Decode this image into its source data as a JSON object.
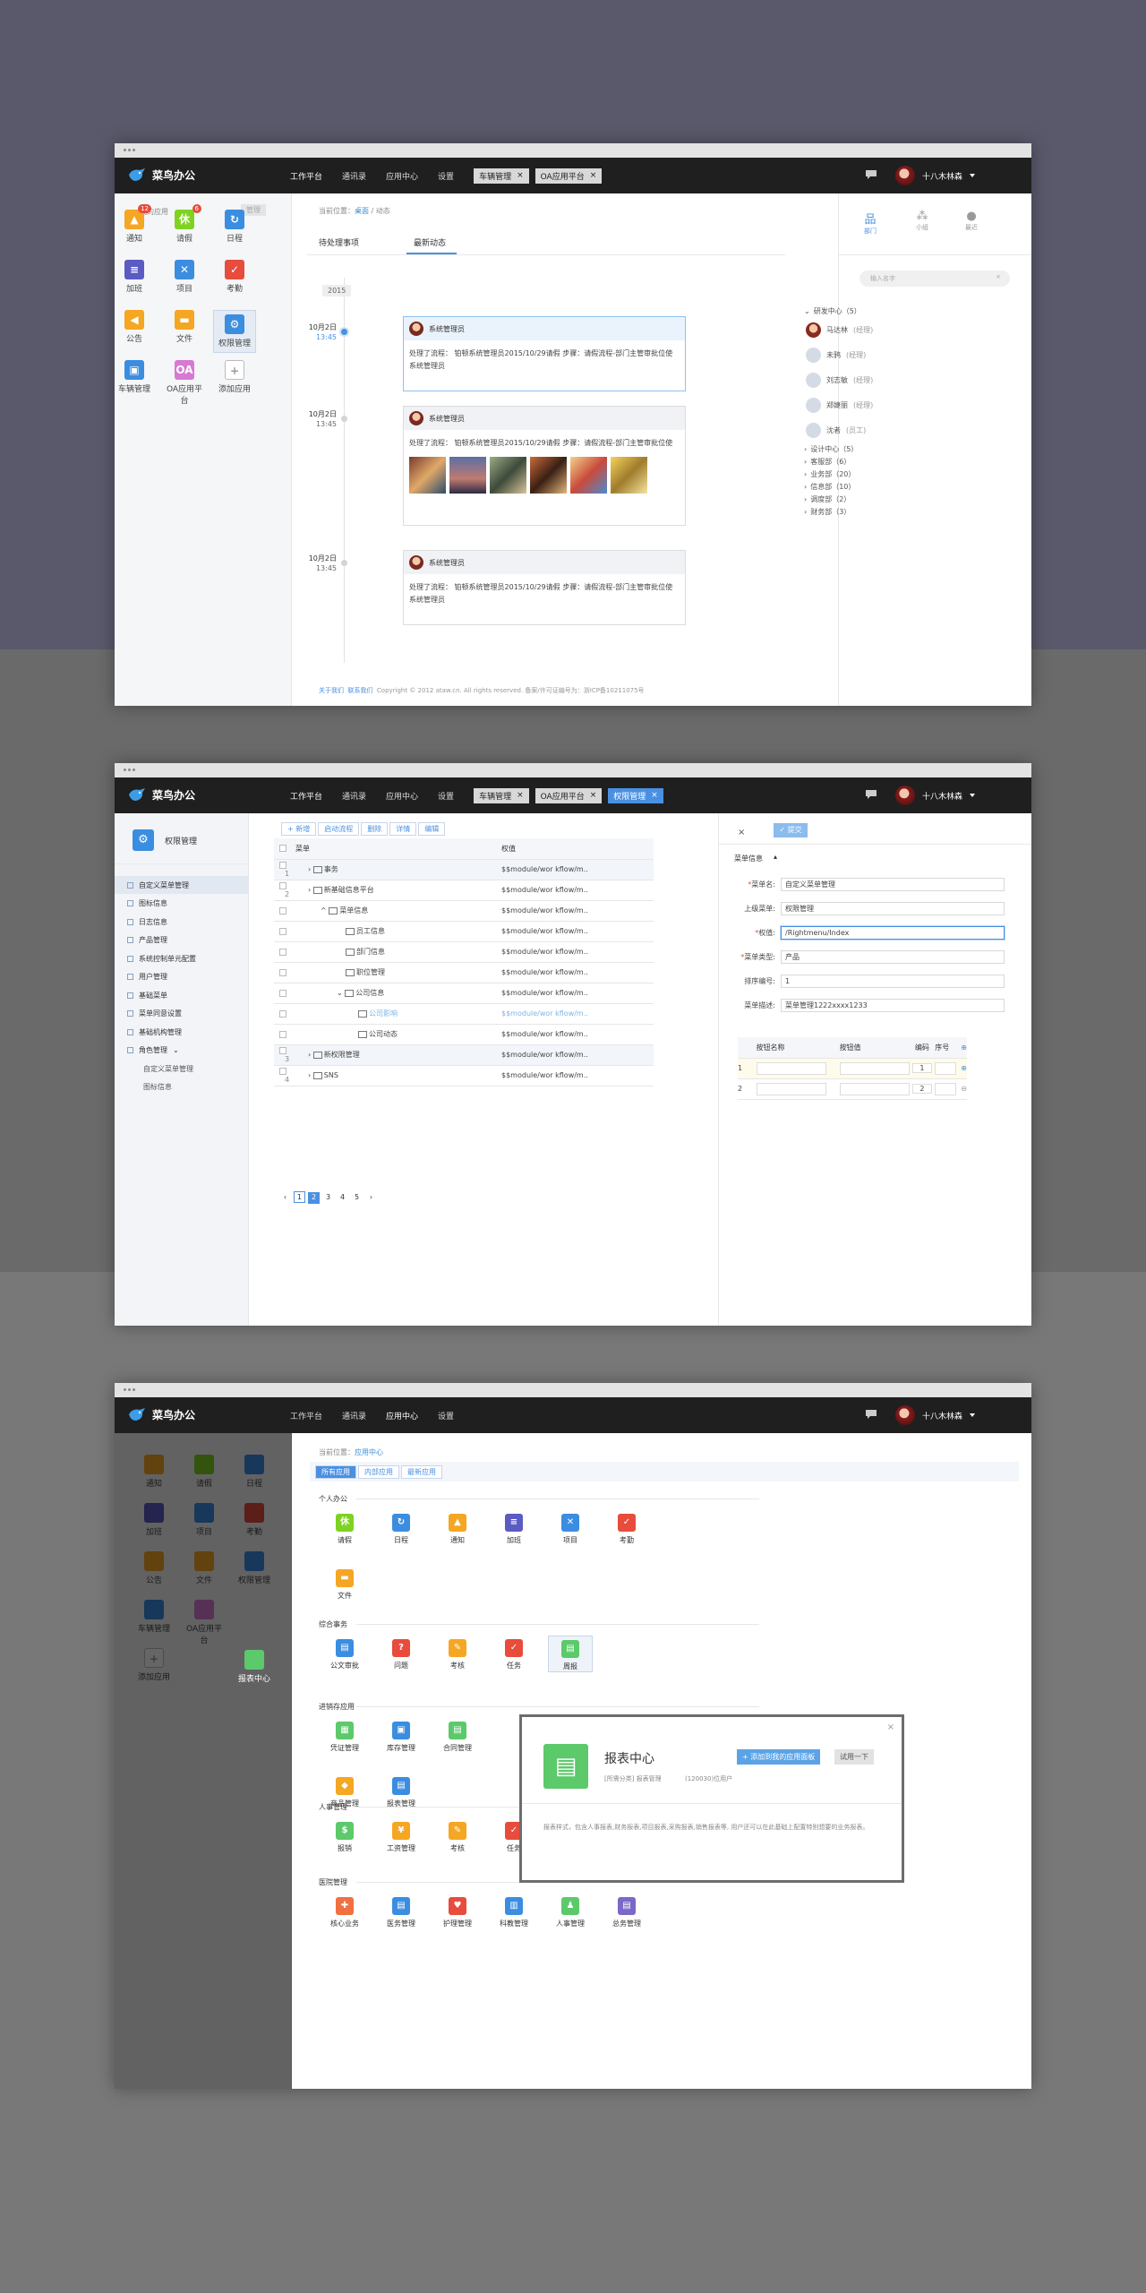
{
  "brand": "菜鸟办公",
  "nav": {
    "work": "工作平台",
    "contacts": "通讯录",
    "appcenter": "应用中心",
    "settings": "设置"
  },
  "tabs": {
    "vehicle": "车辆管理",
    "oa": "OA应用平台",
    "perm": "权限管理",
    "close": "×"
  },
  "user": {
    "name": "十八木林森"
  },
  "w1": {
    "my_apps": "我的应用",
    "manage": "管理",
    "apps": [
      {
        "label": "通知",
        "badge": "12",
        "color": "#f5a623",
        "glyph": "▲"
      },
      {
        "label": "请假",
        "badge": "6",
        "color": "#7ed321",
        "glyph": "休"
      },
      {
        "label": "日程",
        "badge": "",
        "color": "#3b8de0",
        "glyph": "↻"
      },
      {
        "label": "加班",
        "badge": "",
        "color": "#5b5bc4",
        "glyph": "≡"
      },
      {
        "label": "项目",
        "badge": "",
        "color": "#3b8de0",
        "glyph": "✕"
      },
      {
        "label": "考勤",
        "badge": "",
        "color": "#e74c3c",
        "glyph": "✓"
      },
      {
        "label": "公告",
        "badge": "",
        "color": "#f5a623",
        "glyph": "◀"
      },
      {
        "label": "文件",
        "badge": "",
        "color": "#f5a623",
        "glyph": "▬"
      },
      {
        "label": "权限管理",
        "badge": "",
        "color": "#3b8de0",
        "glyph": "⚙"
      },
      {
        "label": "车辆管理",
        "badge": "",
        "color": "#3b8de0",
        "glyph": "▣"
      },
      {
        "label": "OA应用平台",
        "badge": "",
        "color": "#d67ad4",
        "glyph": "OA"
      },
      {
        "label": "添加应用",
        "badge": "",
        "color": "#fff",
        "glyph": "+"
      }
    ],
    "crumb_prefix": "当前位置：",
    "crumb_home": "桌面",
    "crumb_sep": "/",
    "crumb_cur": "动态",
    "tab_todo": "待处理事项",
    "tab_news": "最新动态",
    "year": "2015",
    "items": [
      {
        "date": "10月2日",
        "time": "13:45",
        "author": "系统管理员",
        "body": "处理了流程：    铂顿系统管理员2015/10/29请假 步骤：请假流程-部门主管审批位使系统管理员"
      },
      {
        "date": "10月2日",
        "time": "13:45",
        "author": "系统管理员",
        "body": "处理了流程：    铂顿系统管理员2015/10/29请假 步骤：请假流程-部门主管审批位使"
      },
      {
        "date": "10月2日",
        "time": "13:45",
        "author": "系统管理员",
        "body": "处理了流程：    铂顿系统管理员2015/10/29请假 步骤：请假流程-部门主管审批位使系统管理员"
      }
    ],
    "footer": {
      "about": "关于我们",
      "contact": "联系我们",
      "copy": "Copyright © 2012 ataw.cn. All rights reserved. 备案/许可证编号为：浙ICP备10211075号"
    },
    "rtabs": [
      "部门",
      "小组",
      "最近"
    ],
    "search_ph": "输入名字",
    "dept_top": "研发中心（5）",
    "people": [
      {
        "name": "马达林",
        "role": "(经理)"
      },
      {
        "name": "未鸦",
        "role": "(经理)"
      },
      {
        "name": "刘志敏",
        "role": "(经理)"
      },
      {
        "name": "郑婕丽",
        "role": "(经理)"
      },
      {
        "name": "沈者",
        "role": "(员工)"
      }
    ],
    "depts": [
      "设计中心（5）",
      "客服部（6）",
      "业务部（20）",
      "信息部（10）",
      "调度部（2）",
      "财务部（3）"
    ]
  },
  "w2": {
    "module": "权限管理",
    "menu": [
      "自定义菜单管理",
      "图标信息",
      "日志信息",
      "产品管理",
      "系统控制单元配置",
      "用户管理",
      "基础菜单",
      "菜单同意设置",
      "基础机构管理",
      "角色管理"
    ],
    "menu_sub": [
      "自定义菜单管理",
      "图标信息"
    ],
    "toolbar": [
      "+ 新增",
      "启动流程",
      "删除",
      "详情",
      "编辑"
    ],
    "col_menu": "菜单",
    "col_perm": "权值",
    "rows": [
      {
        "no": "1",
        "name": "事务",
        "perm": "$$module/wor kflow/m.."
      },
      {
        "no": "2",
        "name": "新基础信息平台",
        "perm": "$$module/wor kflow/m.."
      },
      {
        "no": "",
        "name": "菜单信息",
        "perm": "$$module/wor kflow/m.."
      },
      {
        "no": "",
        "name": "员工信息",
        "perm": "$$module/wor kflow/m.."
      },
      {
        "no": "",
        "name": "部门信息",
        "perm": "$$module/wor kflow/m.."
      },
      {
        "no": "",
        "name": "职位管理",
        "perm": "$$module/wor kflow/m.."
      },
      {
        "no": "",
        "name": "公司信息",
        "perm": "$$module/wor kflow/m.."
      },
      {
        "no": "",
        "name": "公司影响",
        "perm": "$$module/wor kflow/m.."
      },
      {
        "no": "",
        "name": "公司动态",
        "perm": "$$module/wor kflow/m.."
      },
      {
        "no": "3",
        "name": "新权限管理",
        "perm": "$$module/wor kflow/m.."
      },
      {
        "no": "4",
        "name": "SNS",
        "perm": "$$module/wor kflow/m.."
      }
    ],
    "pager": [
      "‹",
      "1",
      "2",
      "3",
      "4",
      "5",
      "›"
    ],
    "submit": "✓ 提交",
    "section": "菜单信息",
    "fields": [
      {
        "label": "菜单名:",
        "req": "*",
        "value": "自定义菜单管理"
      },
      {
        "label": "上级菜单:",
        "req": "",
        "value": "权限管理"
      },
      {
        "label": "权值:",
        "req": "*",
        "value": "/Rightmenu/Index"
      },
      {
        "label": "菜单类型:",
        "req": "*",
        "value": "产品"
      },
      {
        "label": "排序编号:",
        "req": "",
        "value": "1"
      },
      {
        "label": "菜单描述:",
        "req": "",
        "value": "菜单管理1222xxxx1233"
      }
    ],
    "grid_head": [
      "按钮名称",
      "按钮值",
      "编码",
      "序号"
    ],
    "grid_rows": [
      {
        "n": "1",
        "code": "1"
      },
      {
        "n": "2",
        "code": "2"
      }
    ]
  },
  "w3": {
    "crumb_prefix": "当前位置：",
    "crumb_cur": "应用中心",
    "filter": [
      "所有应用",
      "内部应用",
      "最新应用"
    ],
    "groups": [
      {
        "title": "个人办公",
        "apps": [
          {
            "l": "请假",
            "c": "#7ed321",
            "g": "休"
          },
          {
            "l": "日程",
            "c": "#3b8de0",
            "g": "↻"
          },
          {
            "l": "通知",
            "c": "#f5a623",
            "g": "▲"
          },
          {
            "l": "加班",
            "c": "#5b5bc4",
            "g": "≡"
          },
          {
            "l": "项目",
            "c": "#3b8de0",
            "g": "✕"
          },
          {
            "l": "考勤",
            "c": "#e74c3c",
            "g": "✓"
          },
          {
            "l": "文件",
            "c": "#f5a623",
            "g": "▬"
          }
        ]
      },
      {
        "title": "综合事务",
        "apps": [
          {
            "l": "公文审批",
            "c": "#3b8de0",
            "g": "▤"
          },
          {
            "l": "问题",
            "c": "#e74c3c",
            "g": "?"
          },
          {
            "l": "考核",
            "c": "#f5a623",
            "g": "✎"
          },
          {
            "l": "任务",
            "c": "#e74c3c",
            "g": "✓"
          },
          {
            "l": "周报",
            "c": "#5cc96a",
            "g": "▤"
          }
        ]
      },
      {
        "title": "进销存应用",
        "apps": [
          {
            "l": "凭证管理",
            "c": "#5cc96a",
            "g": "▦"
          },
          {
            "l": "库存管理",
            "c": "#3b8de0",
            "g": "▣"
          },
          {
            "l": "合同管理",
            "c": "#5cc96a",
            "g": "▤"
          },
          {
            "l": "商品管理",
            "c": "#f5a623",
            "g": "◆"
          },
          {
            "l": "报表管理",
            "c": "#3b8de0",
            "g": "▤"
          }
        ]
      },
      {
        "title": "人事管理",
        "apps": [
          {
            "l": "报销",
            "c": "#5cc96a",
            "g": "$"
          },
          {
            "l": "工资管理",
            "c": "#f5a623",
            "g": "¥"
          },
          {
            "l": "考核",
            "c": "#f5a623",
            "g": "✎"
          },
          {
            "l": "任务",
            "c": "#e74c3c",
            "g": "✓"
          },
          {
            "l": "报表中心",
            "c": "#5cc96a",
            "g": "▤"
          }
        ]
      },
      {
        "title": "医院管理",
        "apps": [
          {
            "l": "核心业务",
            "c": "#f07040",
            "g": "✚"
          },
          {
            "l": "医务管理",
            "c": "#3b8de0",
            "g": "▤"
          },
          {
            "l": "护理管理",
            "c": "#e74c3c",
            "g": "♥"
          },
          {
            "l": "科教管理",
            "c": "#3b8de0",
            "g": "▥"
          },
          {
            "l": "人事管理",
            "c": "#5cc96a",
            "g": "♟"
          },
          {
            "l": "总务管理",
            "c": "#7b68c8",
            "g": "▤"
          }
        ]
      }
    ],
    "side_apps": [
      "通知",
      "请假",
      "日程",
      "加班",
      "项目",
      "考勤",
      "公告",
      "文件",
      "权限管理",
      "车辆管理",
      "OA应用平台",
      "报表中心",
      "添加应用"
    ],
    "popup": {
      "title": "报表中心",
      "meta1": "[所需分类] 报表管理",
      "meta2": "(120030)位用户",
      "add": "+ 添加到我的应用面板",
      "try": "试用一下",
      "desc": "报表样式，包含人事报表,财务报表,项目报表,采购报表,销售报表等, 用户还可以在此基础上配置特别想要的业务报表。",
      "close": "×"
    }
  }
}
